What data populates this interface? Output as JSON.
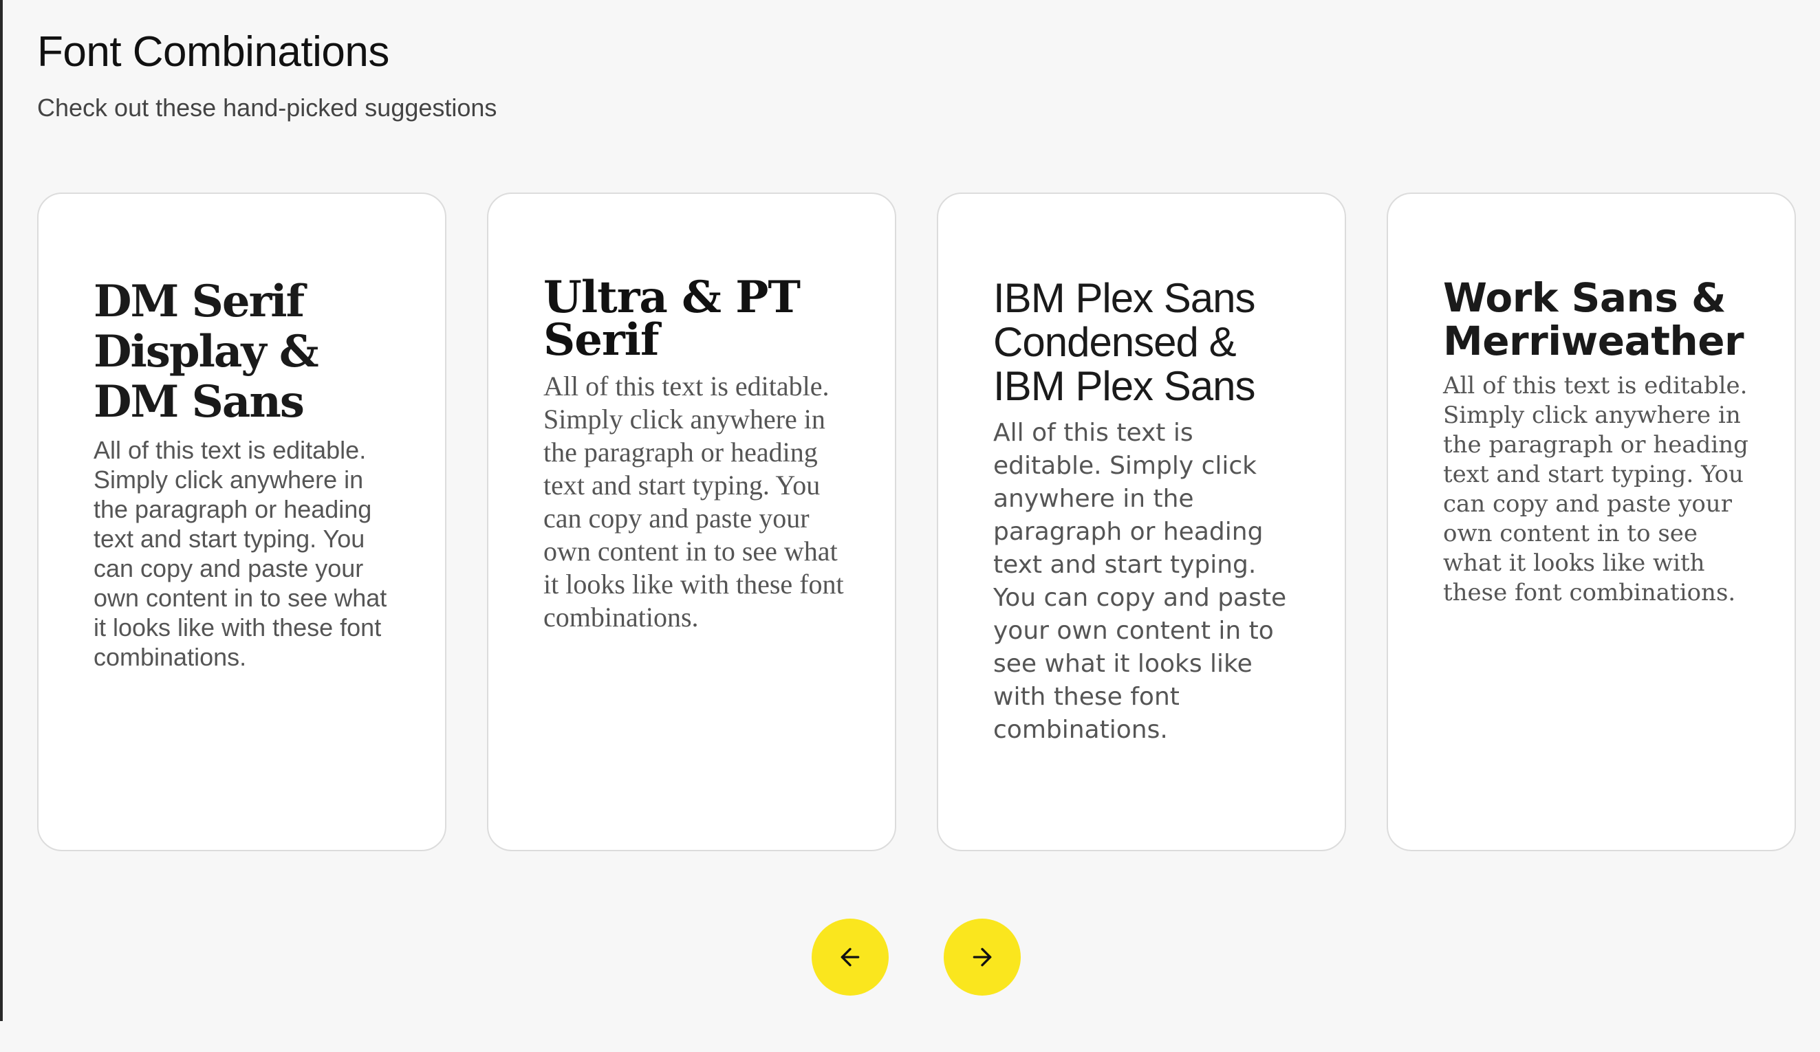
{
  "header": {
    "title": "Font Combinations",
    "subtitle": "Check out these hand-picked suggestions"
  },
  "cards": [
    {
      "heading": "DM Serif Display & DM Sans",
      "body": "All of this text is editable. Simply click anywhere in the paragraph or heading text and start typing. You can copy and paste your own content in to see what it looks like with these font combinations."
    },
    {
      "heading": "Ultra & PT Serif",
      "body": "All of this text is editable. Simply click anywhere in the paragraph or heading text and start typing. You can copy and paste your own content in to see what it looks like with these font combinations."
    },
    {
      "heading": "IBM Plex Sans Condensed & IBM Plex Sans",
      "body": "All of this text is editable. Simply click anywhere in the paragraph or heading text and start typing. You can copy and paste your own content in to see what it looks like with these font combinations."
    },
    {
      "heading": "Work Sans & Merriweather",
      "body": "All of this text is editable. Simply click anywhere in the paragraph or heading text and start typing. You can copy and paste your own content in to see what it looks like with these font combinations."
    }
  ],
  "navigation": {
    "prev_icon": "arrow-left-icon",
    "next_icon": "arrow-right-icon",
    "button_color": "#fae61e"
  }
}
